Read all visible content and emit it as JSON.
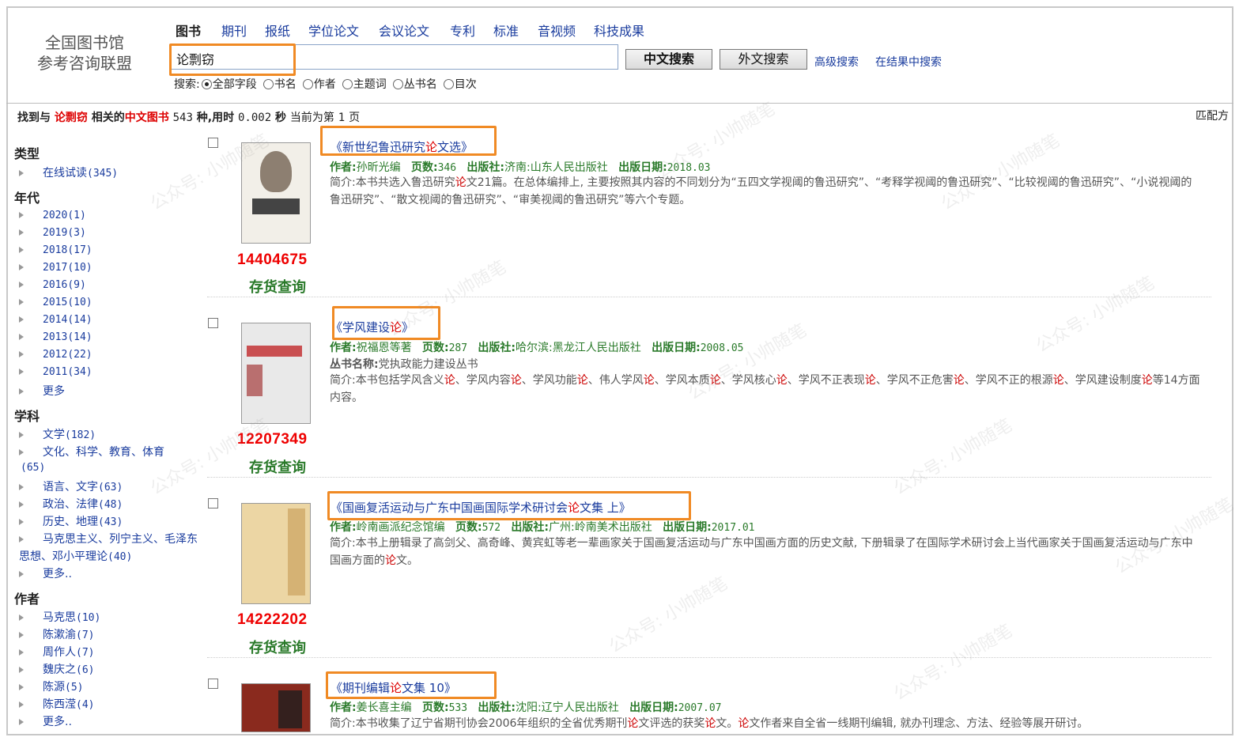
{
  "logo": {
    "line1": "全国图书馆",
    "line2": "参考咨询联盟"
  },
  "nav": {
    "tabs": [
      "图书",
      "期刊",
      "报纸",
      "学位论文",
      "会议论文",
      "专利",
      "标准",
      "音视频",
      "科技成果"
    ]
  },
  "search": {
    "value": "论剽窃",
    "cn_button": "中文搜索",
    "foreign_button": "外文搜索",
    "advanced": "高级搜索",
    "within": "在结果中搜索",
    "field_label": "搜索:",
    "fields": [
      "全部字段",
      "书名",
      "作者",
      "主题词",
      "丛书名",
      "目次"
    ],
    "selected_field": "全部字段"
  },
  "summary": {
    "prefix": "找到与",
    "keyword": "论剽窃",
    "mid": "相关的",
    "category": "中文图书",
    "count": "543",
    "unit": "种,用时",
    "time": "0.002",
    "sec": "秒",
    "page_prefix": "当前为第",
    "page": "1",
    "page_suffix": "页",
    "match": "匹配方"
  },
  "facets": {
    "type": {
      "label": "类型",
      "items": [
        {
          "label": "在线试读",
          "count": "(345)"
        }
      ]
    },
    "year": {
      "label": "年代",
      "items": [
        {
          "label": "2020",
          "count": "(1)"
        },
        {
          "label": "2019",
          "count": "(3)"
        },
        {
          "label": "2018",
          "count": "(17)"
        },
        {
          "label": "2017",
          "count": "(10)"
        },
        {
          "label": "2016",
          "count": "(9)"
        },
        {
          "label": "2015",
          "count": "(10)"
        },
        {
          "label": "2014",
          "count": "(14)"
        },
        {
          "label": "2013",
          "count": "(14)"
        },
        {
          "label": "2012",
          "count": "(22)"
        },
        {
          "label": "2011",
          "count": "(34)"
        }
      ],
      "more": "更多"
    },
    "subject": {
      "label": "学科",
      "items": [
        {
          "label": "文学",
          "count": "(182)"
        },
        {
          "label": "文化、科学、教育、体育",
          "count": "(65)"
        },
        {
          "label": "语言、文字",
          "count": "(63)"
        },
        {
          "label": "政治、法律",
          "count": "(48)"
        },
        {
          "label": "历史、地理",
          "count": "(43)"
        },
        {
          "label": "马克思主义、列宁主义、毛泽东思想、邓小平理论",
          "count": "(40)"
        }
      ],
      "more": "更多.."
    },
    "author": {
      "label": "作者",
      "items": [
        {
          "label": "马克思",
          "count": "(10)"
        },
        {
          "label": "陈漱渝",
          "count": "(7)"
        },
        {
          "label": "周作人",
          "count": "(7)"
        },
        {
          "label": "魏庆之",
          "count": "(6)"
        },
        {
          "label": "陈源",
          "count": "(5)"
        },
        {
          "label": "陈西滢",
          "count": "(4)"
        }
      ],
      "more": "更多.."
    }
  },
  "results": [
    {
      "title_pre": "《新世纪鲁迅研究",
      "title_hl": "论",
      "title_post": "文选》",
      "author_label": "作者:",
      "author": "孙昕光编",
      "pages_label": "页数:",
      "pages": "346",
      "publisher_label": "出版社:",
      "publisher": "济南:山东人民出版社",
      "date_label": "出版日期:",
      "date": "2018.03",
      "abstract": "简介:本书共选入鲁迅研究论文21篇。在总体编排上, 主要按照其内容的不同划分为“五四文学视阈的鲁迅研究”、“考释学视阈的鲁迅研究”、“比较视阈的鲁迅研究”、“小说视阈的鲁迅研究”、“散文视阈的鲁迅研究”、“审美视阈的鲁迅研究”等六个专题。",
      "id": "14404675",
      "stock": "存货查询",
      "cover": "#f2efe8"
    },
    {
      "title_pre": "《学风建设",
      "title_hl": "论",
      "title_post": "》",
      "author_label": "作者:",
      "author": "祝福恩等著",
      "pages_label": "页数:",
      "pages": "287",
      "publisher_label": "出版社:",
      "publisher": "哈尔滨:黑龙江人民出版社",
      "date_label": "出版日期:",
      "date": "2008.05",
      "series_label": "丛书名称:",
      "series": "党执政能力建设丛书",
      "abstract": "简介:本书包括学风含义论、学风内容论、学风功能论、伟人学风论、学风本质论、学风核心论、学风不正表现论、学风不正危害论、学风不正的根源论、学风建设制度论等14方面内容。",
      "id": "12207349",
      "stock": "存货查询",
      "cover": "#e9e9e9"
    },
    {
      "title_pre": "《国画复活运动与广东中国画国际学术研讨会",
      "title_hl": "论",
      "title_post": "文集 上》",
      "author_label": "作者:",
      "author": "岭南画派纪念馆编",
      "pages_label": "页数:",
      "pages": "572",
      "publisher_label": "出版社:",
      "publisher": "广州:岭南美术出版社",
      "date_label": "出版日期:",
      "date": "2017.01",
      "abstract": "简介:本书上册辑录了高剑父、高奇峰、黄宾虹等老一辈画家关于国画复活运动与广东中国画方面的历史文献, 下册辑录了在国际学术研讨会上当代画家关于国画复活运动与广东中国画方面的论文。",
      "id": "14222202",
      "stock": "存货查询",
      "cover": "#ecd6a4"
    },
    {
      "title_pre": "《期刊编辑",
      "title_hl": "论",
      "title_post": "文集 10》",
      "author_label": "作者:",
      "author": "姜长喜主编",
      "pages_label": "页数:",
      "pages": "533",
      "publisher_label": "出版社:",
      "publisher": "沈阳:辽宁人民出版社",
      "date_label": "出版日期:",
      "date": "2007.07",
      "abstract": "简介:本书收集了辽宁省期刊协会2006年组织的全省优秀期刊论文评选的获奖论文。论文作者来自全省一线期刊编辑, 就办刊理念、方法、经验等展开研讨。",
      "id": "",
      "stock": "",
      "cover": "#8a2a1e"
    }
  ],
  "watermark": "公众号: 小帅随笔",
  "colors": {
    "link": "#1a3c9e",
    "highlight": "#d00000",
    "meta_green": "#2a7a2a",
    "annotation_orange": "#f08a24"
  }
}
